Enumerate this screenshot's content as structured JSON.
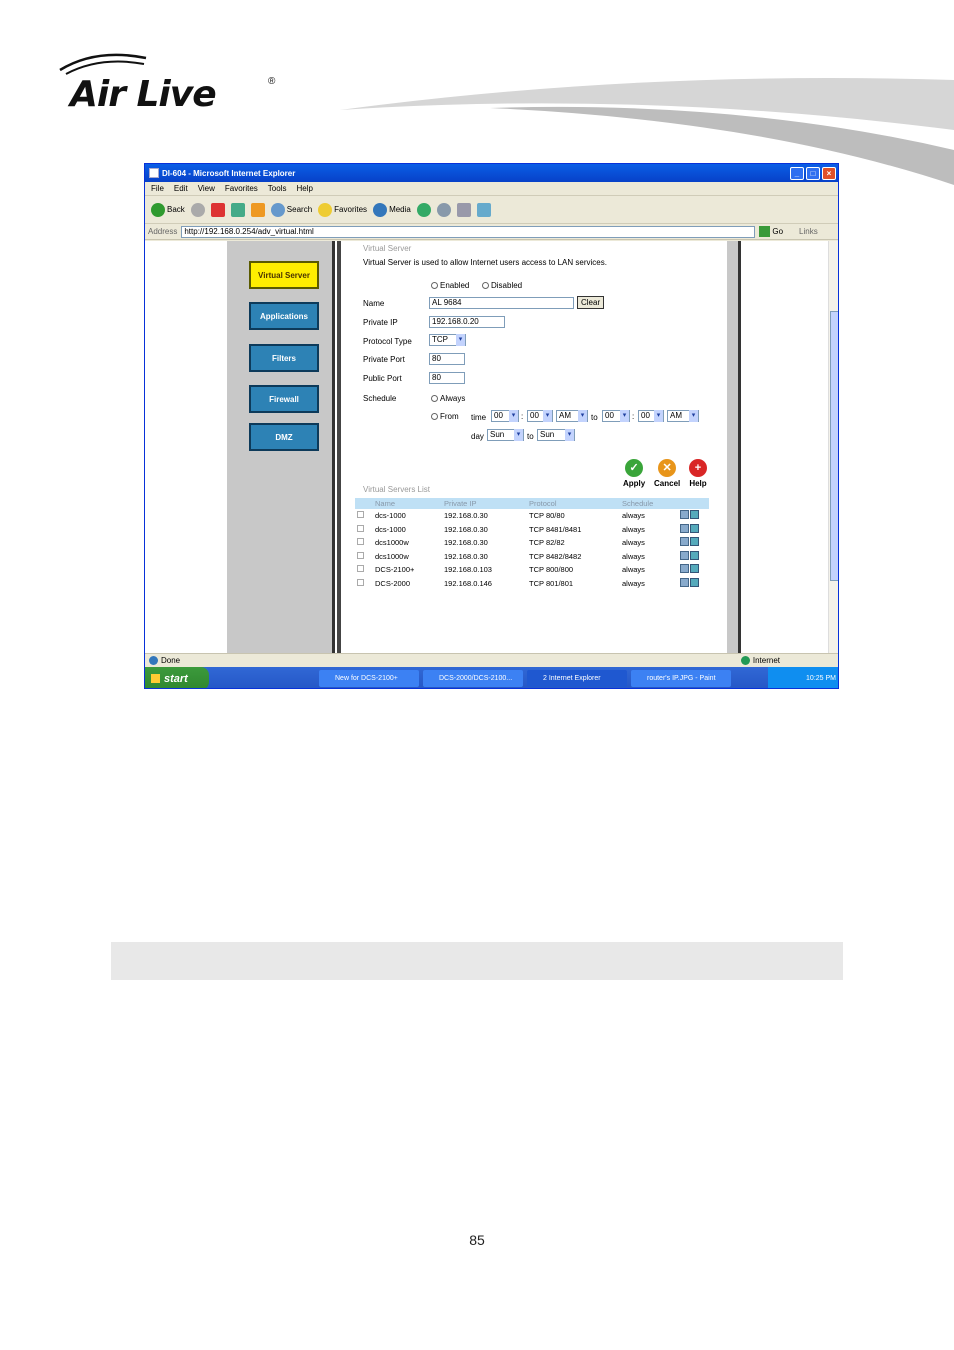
{
  "brand": {
    "logo_text": "Air Live",
    "reg": "®"
  },
  "window": {
    "title": "DI-604 - Microsoft Internet Explorer",
    "minimize": "_",
    "maximize": "□",
    "close": "×"
  },
  "menu": [
    "File",
    "Edit",
    "View",
    "Favorites",
    "Tools",
    "Help"
  ],
  "toolbar": {
    "back": "Back",
    "search": "Search",
    "favorites": "Favorites",
    "media": "Media"
  },
  "address": {
    "label": "Address",
    "url": "http://192.168.0.254/adv_virtual.html",
    "go": "Go",
    "links": "Links"
  },
  "sidebar": [
    "Virtual Server",
    "Applications",
    "Filters",
    "Firewall",
    "DMZ"
  ],
  "form": {
    "heading": "Virtual Server",
    "description": "Virtual Server is used to allow Internet users access to LAN services.",
    "enabled": "Enabled",
    "disabled": "Disabled",
    "name_label": "Name",
    "name_value": "AL 9684",
    "clear": "Clear",
    "private_ip_label": "Private IP",
    "private_ip_value": "192.168.0.20",
    "protocol_label": "Protocol Type",
    "protocol_value": "TCP",
    "private_port_label": "Private Port",
    "private_port_value": "80",
    "public_port_label": "Public Port",
    "public_port_value": "80",
    "schedule_label": "Schedule",
    "always": "Always",
    "from": "From",
    "time": "time",
    "h1": "00",
    "m1": "00",
    "ampm1": "AM",
    "to": "to",
    "h2": "00",
    "m2": "00",
    "ampm2": "AM",
    "colon": ":",
    "day": "day",
    "day1": "Sun",
    "day2": "Sun"
  },
  "actions": {
    "apply": "Apply",
    "cancel": "Cancel",
    "help": "Help"
  },
  "list": {
    "heading": "Virtual Servers List",
    "columns": [
      "Name",
      "Private IP",
      "Protocol",
      "Schedule"
    ],
    "rows": [
      {
        "name": "dcs-1000",
        "ip": "192.168.0.30",
        "protocol": "TCP 80/80",
        "schedule": "always"
      },
      {
        "name": "dcs-1000",
        "ip": "192.168.0.30",
        "protocol": "TCP 8481/8481",
        "schedule": "always"
      },
      {
        "name": "dcs1000w",
        "ip": "192.168.0.30",
        "protocol": "TCP 82/82",
        "schedule": "always"
      },
      {
        "name": "dcs1000w",
        "ip": "192.168.0.30",
        "protocol": "TCP 8482/8482",
        "schedule": "always"
      },
      {
        "name": "DCS-2100+",
        "ip": "192.168.0.103",
        "protocol": "TCP 800/800",
        "schedule": "always"
      },
      {
        "name": "DCS-2000",
        "ip": "192.168.0.146",
        "protocol": "TCP 801/801",
        "schedule": "always"
      }
    ]
  },
  "status": {
    "done": "Done",
    "zone": "Internet"
  },
  "taskbar": {
    "start": "start",
    "tasks": [
      "New for DCS-2100+",
      "DCS-2000/DCS-2100...",
      "2 Internet Explorer",
      "router's IP.JPG - Paint"
    ],
    "clock": "10:25 PM"
  },
  "page_number": "85"
}
